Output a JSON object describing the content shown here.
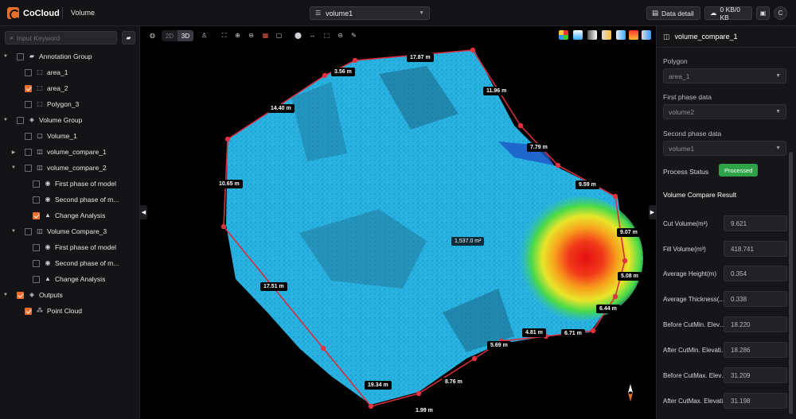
{
  "header": {
    "logo_text": "CoCloud",
    "page_name": "Volume",
    "dataset": "volume1",
    "data_detail_label": "Data detail",
    "transfer_label": "0 KB/0 KB"
  },
  "sidebar": {
    "search_placeholder": "Input Keyword",
    "tree": [
      {
        "label": "Annotation Group",
        "level": 0,
        "arrow": "down",
        "checked": false,
        "icon": "folder-icon"
      },
      {
        "label": "area_1",
        "level": 1,
        "arrow": "",
        "checked": false,
        "icon": "polygon-icon"
      },
      {
        "label": "area_2",
        "level": 1,
        "arrow": "",
        "checked": true,
        "icon": "polygon-icon"
      },
      {
        "label": "Polygon_3",
        "level": 1,
        "arrow": "",
        "checked": false,
        "icon": "polygon-icon"
      },
      {
        "label": "Volume Group",
        "level": 0,
        "arrow": "down",
        "checked": false,
        "icon": "cube-icon"
      },
      {
        "label": "Volume_1",
        "level": 1,
        "arrow": "",
        "checked": false,
        "icon": "box-icon"
      },
      {
        "label": "volume_compare_1",
        "level": 1,
        "arrow": "right",
        "checked": false,
        "icon": "compare-icon"
      },
      {
        "label": "volume_compare_2",
        "level": 1,
        "arrow": "down",
        "checked": false,
        "icon": "compare-icon"
      },
      {
        "label": "First phase of model",
        "level": 2,
        "arrow": "",
        "checked": false,
        "icon": "model-icon"
      },
      {
        "label": "Second phase of m...",
        "level": 2,
        "arrow": "",
        "checked": false,
        "icon": "model-icon"
      },
      {
        "label": "Change Analysis",
        "level": 2,
        "arrow": "",
        "checked": true,
        "icon": "chart-icon"
      },
      {
        "label": "Volume Compare_3",
        "level": 1,
        "arrow": "down",
        "checked": false,
        "icon": "compare-icon"
      },
      {
        "label": "First phase of model",
        "level": 2,
        "arrow": "",
        "checked": false,
        "icon": "model-icon"
      },
      {
        "label": "Second phase of m...",
        "level": 2,
        "arrow": "",
        "checked": false,
        "icon": "model-icon"
      },
      {
        "label": "Change Analysis",
        "level": 2,
        "arrow": "",
        "checked": false,
        "icon": "chart-icon"
      },
      {
        "label": "Outputs",
        "level": 0,
        "arrow": "down",
        "checked": true,
        "icon": "cube-icon"
      },
      {
        "label": "Point Cloud",
        "level": 1,
        "arrow": "",
        "checked": true,
        "icon": "point-cloud-icon"
      }
    ]
  },
  "viewport": {
    "view_2d": "2D",
    "view_3d": "3D",
    "area": "1,537.0 m²",
    "measurements": [
      "17.87 m",
      "3.56 m",
      "11.96 m",
      "14.40 m",
      "7.79 m",
      "10.65 m",
      "9.59 m",
      "9.07 m",
      "5.08 m",
      "6.44 m",
      "6.71 m",
      "4.81 m",
      "5.69 m",
      "8.76 m",
      "19.34 m",
      "1.99 m",
      "17.51 m"
    ]
  },
  "panel": {
    "title": "volume_compare_1",
    "polygon_label": "Polygon",
    "polygon_value": "area_1",
    "first_phase_label": "First phase data",
    "first_phase_value": "volume2",
    "second_phase_label": "Second phase data",
    "second_phase_value": "volume1",
    "status_label": "Process Status",
    "status_value": "Processed",
    "status_color": "#2fa34a",
    "result_title": "Volume Compare Result",
    "results": [
      {
        "label": "Cut Volume(m³)",
        "value": "9.621"
      },
      {
        "label": "Fill Volume(m³)",
        "value": "418.741"
      },
      {
        "label": "Average Height(m)",
        "value": "0.354"
      },
      {
        "label": "Average Thickness(...",
        "value": "0.338"
      },
      {
        "label": "Before CutMin. Elevati...",
        "value": "18.220"
      },
      {
        "label": "After CutMin. Elevatio...",
        "value": "18.286"
      },
      {
        "label": "Before CutMax. Elevat...",
        "value": "31.209"
      },
      {
        "label": "After CutMax. Elevati...",
        "value": "31.198"
      }
    ]
  },
  "colors": {
    "accent": "#e8702a",
    "point_cloud": "#27b5e6"
  }
}
